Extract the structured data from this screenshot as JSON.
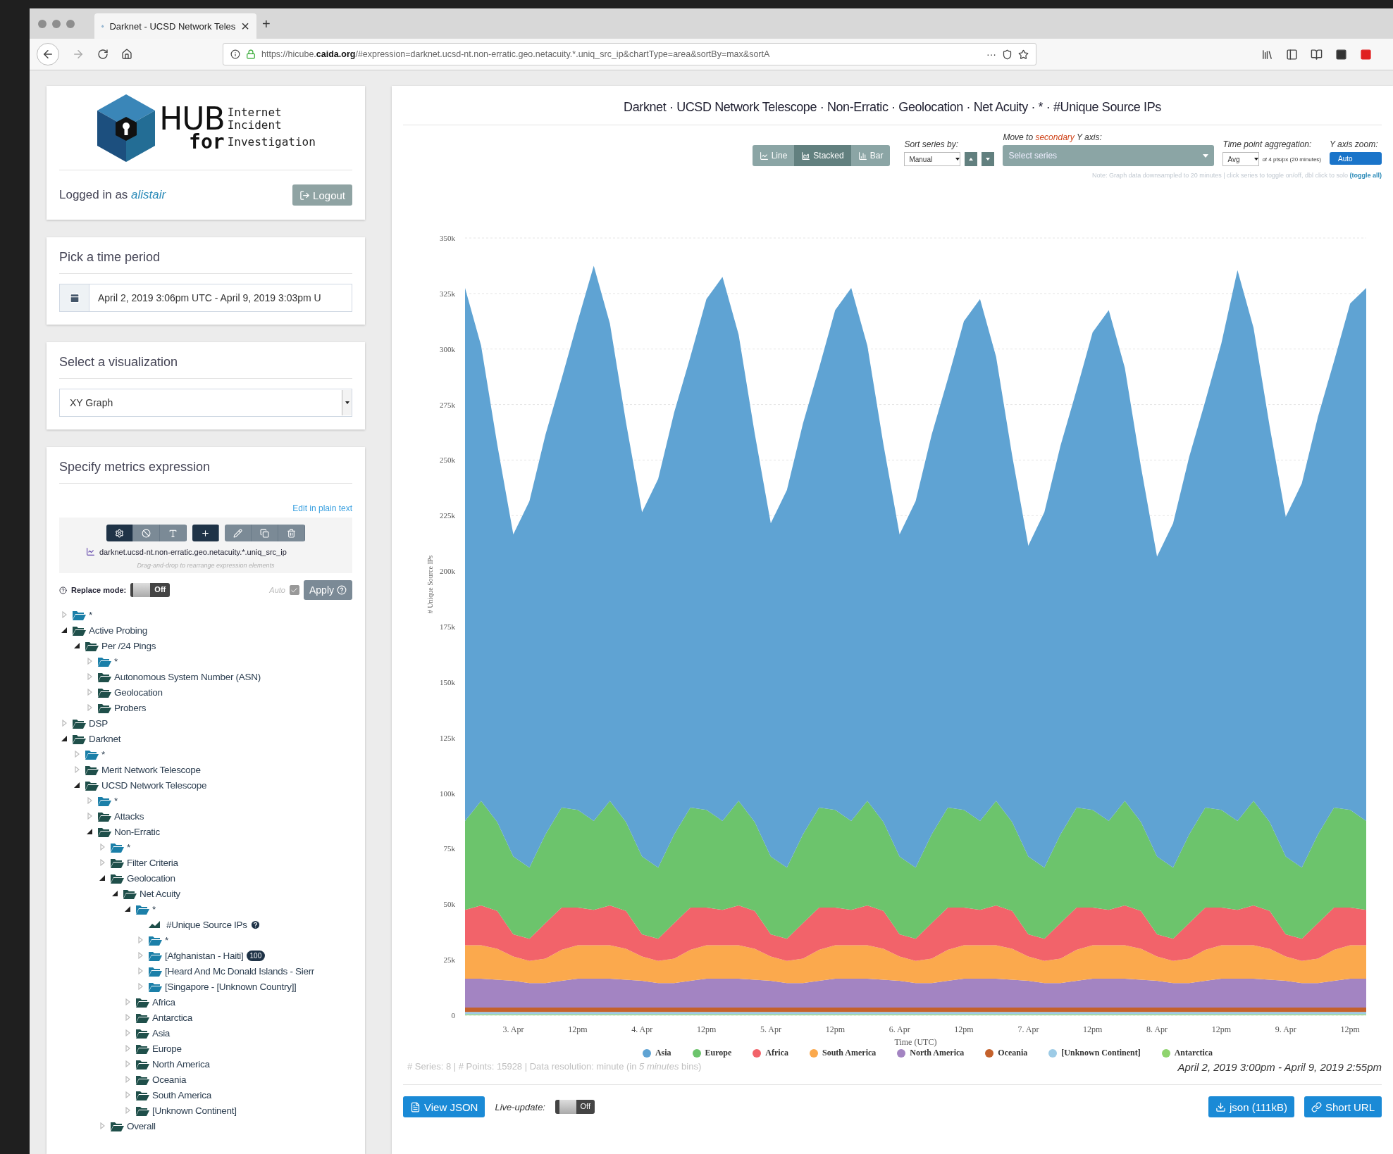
{
  "browser": {
    "tab_title": "Darknet - UCSD Network Teles",
    "tab_close": "×",
    "new_tab": "+",
    "url": "https://hicube.**caida.org**/#expression=darknet.ucsd-nt.non-erratic.geo.netacuity.*.uniq_src_ip&chartType=area&sortBy=max&sortA",
    "more": "···"
  },
  "logo": {
    "hub": "HUB",
    "for": "for",
    "lines": [
      "Internet",
      "Incident",
      "Investigation"
    ]
  },
  "login": {
    "prefix": "Logged in as",
    "user": "alistair",
    "logout": "Logout"
  },
  "time_period": {
    "title": "Pick a time period",
    "value": "April 2, 2019 3:06pm UTC - April 9, 2019 3:03pm U"
  },
  "visualization": {
    "title": "Select a visualization",
    "value": "XY Graph"
  },
  "metrics": {
    "title": "Specify metrics expression",
    "edit_link": "Edit in plain text",
    "expression": "darknet.ucsd-nt.non-erratic.geo.netacuity.*.uniq_src_ip",
    "hint": "Drag-and-drop to rearrange expression elements",
    "replace_label": "Replace mode:",
    "replace_on": false,
    "replace_state": "Off",
    "auto_label": "Auto",
    "auto_checked": true,
    "apply": "Apply"
  },
  "tree": [
    {
      "label": "*",
      "kind": "wildcard",
      "expanded": false
    },
    {
      "label": "Active Probing",
      "kind": "folder",
      "expanded": true,
      "children": [
        {
          "label": "Per /24 Pings",
          "kind": "folder",
          "expanded": true,
          "children": [
            {
              "label": "*",
              "kind": "wildcard",
              "expanded": false
            },
            {
              "label": "Autonomous System Number (ASN)",
              "kind": "folder",
              "expanded": false
            },
            {
              "label": "Geolocation",
              "kind": "folder",
              "expanded": false
            },
            {
              "label": "Probers",
              "kind": "folder",
              "expanded": false
            }
          ]
        }
      ]
    },
    {
      "label": "DSP",
      "kind": "folder",
      "expanded": false
    },
    {
      "label": "Darknet",
      "kind": "folder",
      "expanded": true,
      "children": [
        {
          "label": "*",
          "kind": "wildcard",
          "expanded": false
        },
        {
          "label": "Merit Network Telescope",
          "kind": "folder",
          "expanded": false
        },
        {
          "label": "UCSD Network Telescope",
          "kind": "folder",
          "expanded": true,
          "children": [
            {
              "label": "*",
              "kind": "wildcard",
              "expanded": false
            },
            {
              "label": "Attacks",
              "kind": "folder",
              "expanded": false
            },
            {
              "label": "Non-Erratic",
              "kind": "folder",
              "expanded": true,
              "children": [
                {
                  "label": "*",
                  "kind": "wildcard",
                  "expanded": false
                },
                {
                  "label": "Filter Criteria",
                  "kind": "folder",
                  "expanded": false
                },
                {
                  "label": "Geolocation",
                  "kind": "folder",
                  "expanded": true,
                  "children": [
                    {
                      "label": "Net Acuity",
                      "kind": "folder",
                      "expanded": true,
                      "children": [
                        {
                          "label": "*",
                          "kind": "wildcard",
                          "expanded": true,
                          "children": [
                            {
                              "label": "#Unique Source IPs",
                              "kind": "metric"
                            },
                            {
                              "label": "*",
                              "kind": "wildcard",
                              "expanded": false
                            },
                            {
                              "label": "[Afghanistan - Haiti]",
                              "kind": "wildcard",
                              "expanded": false,
                              "badge": "100"
                            },
                            {
                              "label": "[Heard And Mc Donald Islands - Sierr",
                              "kind": "wildcard",
                              "expanded": false
                            },
                            {
                              "label": "[Singapore - [Unknown Country]]",
                              "kind": "wildcard",
                              "expanded": false
                            }
                          ]
                        },
                        {
                          "label": "Africa",
                          "kind": "folder",
                          "expanded": false
                        },
                        {
                          "label": "Antarctica",
                          "kind": "folder",
                          "expanded": false
                        },
                        {
                          "label": "Asia",
                          "kind": "folder",
                          "expanded": false
                        },
                        {
                          "label": "Europe",
                          "kind": "folder",
                          "expanded": false
                        },
                        {
                          "label": "North America",
                          "kind": "folder",
                          "expanded": false
                        },
                        {
                          "label": "Oceania",
                          "kind": "folder",
                          "expanded": false
                        },
                        {
                          "label": "South America",
                          "kind": "folder",
                          "expanded": false
                        },
                        {
                          "label": "[Unknown Continent]",
                          "kind": "folder",
                          "expanded": false
                        }
                      ]
                    }
                  ]
                },
                {
                  "label": "Overall",
                  "kind": "folder",
                  "expanded": false
                }
              ]
            }
          ]
        }
      ]
    }
  ],
  "chart": {
    "title": "Darknet · UCSD Network Telescope · Non-Erratic · Geolocation · Net Acuity · * · #Unique Source IPs",
    "modes": [
      {
        "label": "Line",
        "selected": false
      },
      {
        "label": "Stacked",
        "selected": true
      },
      {
        "label": "Bar",
        "selected": false
      }
    ],
    "sort_label": "Sort series by:",
    "sort_value": "Manual",
    "secondary_label": "Move to **secondary** Y axis:",
    "secondary_placeholder": "Select series",
    "aggregation_label": "Time point aggregation:",
    "aggregation_value": "Avg",
    "aggregation_note": "of 4 pts/px (20 minutes)",
    "zoom_label": "Y axis zoom:",
    "zoom_value": "Auto",
    "note": "Note: Graph data downsampled to 20 minutes | click series to toggle on/off, dbl click to solo",
    "toggle_all": "(toggle all)",
    "chart_data": {
      "type": "area",
      "stacked": true,
      "xlabel": "Time (UTC)",
      "ylabel": "# Unique Source IPs",
      "categories": [
        null,
        null,
        null,
        "3. Apr",
        null,
        null,
        null,
        "12pm",
        null,
        null,
        null,
        "4. Apr",
        null,
        null,
        null,
        "12pm",
        null,
        null,
        null,
        "5. Apr",
        null,
        null,
        null,
        "12pm",
        null,
        null,
        null,
        "6. Apr",
        null,
        null,
        null,
        "12pm",
        null,
        null,
        null,
        "7. Apr",
        null,
        null,
        null,
        "12pm",
        null,
        null,
        null,
        "8. Apr",
        null,
        null,
        null,
        "12pm",
        null,
        null,
        null,
        "9. Apr",
        null,
        null,
        null,
        "12pm",
        null
      ],
      "ylim": [
        0,
        350
      ],
      "yticks": [
        {
          "value": 0,
          "label": "0"
        },
        {
          "value": 25,
          "label": "25k"
        },
        {
          "value": 50,
          "label": "50k"
        },
        {
          "value": 75,
          "label": "75k"
        },
        {
          "value": 100,
          "label": "100k"
        },
        {
          "value": 125,
          "label": "125k"
        },
        {
          "value": 150,
          "label": "150k"
        },
        {
          "value": 175,
          "label": "175k"
        },
        {
          "value": 200,
          "label": "200k"
        },
        {
          "value": 225,
          "label": "225k"
        },
        {
          "value": 250,
          "label": "250k"
        },
        {
          "value": 275,
          "label": "275k"
        },
        {
          "value": 300,
          "label": "300k"
        },
        {
          "value": 325,
          "label": "325k"
        },
        {
          "value": 350,
          "label": "350k"
        }
      ],
      "grid": true,
      "series": [
        {
          "name": "Antarctica",
          "color": "#8fd46e",
          "values": [
            0.5,
            0.5,
            0.5,
            0.5,
            0.5,
            0.5,
            0.5,
            0.5,
            0.5,
            0.5,
            0.5,
            0.5,
            0.5,
            0.5,
            0.5,
            0.5,
            0.5,
            0.5,
            0.5,
            0.5,
            0.5,
            0.5,
            0.5,
            0.5,
            0.5,
            0.5,
            0.5,
            0.5,
            0.5,
            0.5,
            0.5,
            0.5,
            0.5,
            0.5,
            0.5,
            0.5,
            0.5,
            0.5,
            0.5,
            0.5,
            0.5,
            0.5,
            0.5,
            0.5,
            0.5,
            0.5,
            0.5,
            0.5,
            0.5,
            0.5,
            0.5,
            0.5,
            0.5,
            0.5,
            0.5,
            0.5,
            0.5
          ]
        },
        {
          "name": "[Unknown Continent]",
          "color": "#9dcbe6",
          "values": [
            1,
            1,
            1,
            1,
            1,
            1,
            1,
            1,
            1,
            1,
            1,
            1,
            1,
            1,
            1,
            1,
            1,
            1,
            1,
            1,
            1,
            1,
            1,
            1,
            1,
            1,
            1,
            1,
            1,
            1,
            1,
            1,
            1,
            1,
            1,
            1,
            1,
            1,
            1,
            1,
            1,
            1,
            1,
            1,
            1,
            1,
            1,
            1,
            1,
            1,
            1,
            1,
            1,
            1,
            1,
            1,
            1
          ]
        },
        {
          "name": "Oceania",
          "color": "#c4612b",
          "values": [
            2,
            2,
            2,
            2,
            2,
            2,
            2,
            2,
            2,
            2,
            2,
            2,
            2,
            2,
            2,
            2,
            2,
            2,
            2,
            2,
            2,
            2,
            2,
            2,
            2,
            2,
            2,
            2,
            2,
            2,
            2,
            2,
            2,
            2,
            2,
            2,
            2,
            2,
            2,
            2,
            2,
            2,
            2,
            2,
            2,
            2,
            2,
            2,
            2,
            2,
            2,
            2,
            2,
            2,
            2,
            2,
            2
          ]
        },
        {
          "name": "North America",
          "color": "#a384c2",
          "values": [
            13,
            13,
            12.5,
            12,
            11,
            11,
            12,
            13,
            13,
            13,
            12.5,
            12,
            11,
            11,
            12,
            13,
            13,
            13,
            12.5,
            12,
            11,
            11,
            12,
            13,
            13,
            13,
            12.5,
            12,
            11,
            11,
            12,
            13,
            13,
            13,
            12.5,
            12,
            11,
            11,
            12,
            13,
            13,
            13,
            12.5,
            12,
            11,
            11,
            12,
            13,
            13,
            13,
            12.5,
            12,
            11,
            11,
            12,
            13,
            13
          ]
        },
        {
          "name": "South America",
          "color": "#fba94d",
          "values": [
            15,
            15,
            14,
            11,
            10,
            11,
            14,
            15,
            15,
            15,
            14,
            11,
            10,
            11,
            14,
            15,
            15,
            15,
            14,
            11,
            10,
            11,
            14,
            15,
            15,
            15,
            14,
            11,
            10,
            11,
            14,
            15,
            15,
            15,
            14,
            11,
            10,
            11,
            14,
            15,
            15,
            15,
            14,
            11,
            10,
            11,
            14,
            15,
            15,
            15,
            14,
            11,
            10,
            11,
            14,
            15,
            15
          ]
        },
        {
          "name": "Africa",
          "color": "#f2636a",
          "values": [
            16,
            18,
            17,
            10,
            10,
            16,
            19,
            17,
            16,
            18,
            17,
            10,
            10,
            16,
            19,
            17,
            16,
            18,
            17,
            10,
            10,
            16,
            19,
            17,
            16,
            18,
            17,
            10,
            10,
            16,
            19,
            17,
            16,
            18,
            17,
            10,
            10,
            16,
            19,
            17,
            16,
            18,
            17,
            10,
            10,
            16,
            19,
            17,
            16,
            18,
            17,
            10,
            10,
            16,
            19,
            17,
            16
          ]
        },
        {
          "name": "Europe",
          "color": "#6cc46c",
          "values": [
            40,
            47,
            40,
            35,
            32,
            40,
            45,
            44,
            40,
            47,
            40,
            35,
            32,
            40,
            45,
            44,
            40,
            47,
            40,
            35,
            32,
            40,
            45,
            44,
            40,
            47,
            40,
            35,
            32,
            40,
            45,
            44,
            40,
            47,
            40,
            35,
            32,
            40,
            45,
            44,
            40,
            47,
            40,
            35,
            32,
            40,
            45,
            44,
            40,
            47,
            40,
            35,
            32,
            40,
            45,
            44,
            40
          ]
        },
        {
          "name": "Asia",
          "color": "#5fa3d3",
          "values": [
            240,
            205,
            170,
            145,
            165,
            180,
            193,
            220,
            250,
            215,
            180,
            155,
            175,
            190,
            203,
            230,
            245,
            210,
            175,
            150,
            170,
            185,
            198,
            225,
            240,
            205,
            170,
            145,
            165,
            180,
            193,
            220,
            235,
            200,
            165,
            140,
            160,
            175,
            188,
            215,
            230,
            195,
            160,
            135,
            155,
            170,
            183,
            210,
            248,
            213,
            178,
            153,
            173,
            188,
            201,
            228,
            240
          ]
        }
      ]
    },
    "stats": "# Series: 8 | # Points: 15928 | Data resolution: minute (in *5 minutes* bins)",
    "range": "April 2, 2019 3:00pm - April 9, 2019 2:55pm",
    "view_json": "View JSON",
    "live_label": "Live-update:",
    "live_on": false,
    "live_state": "Off",
    "download": "json (111kB)",
    "short_url": "Short URL"
  }
}
